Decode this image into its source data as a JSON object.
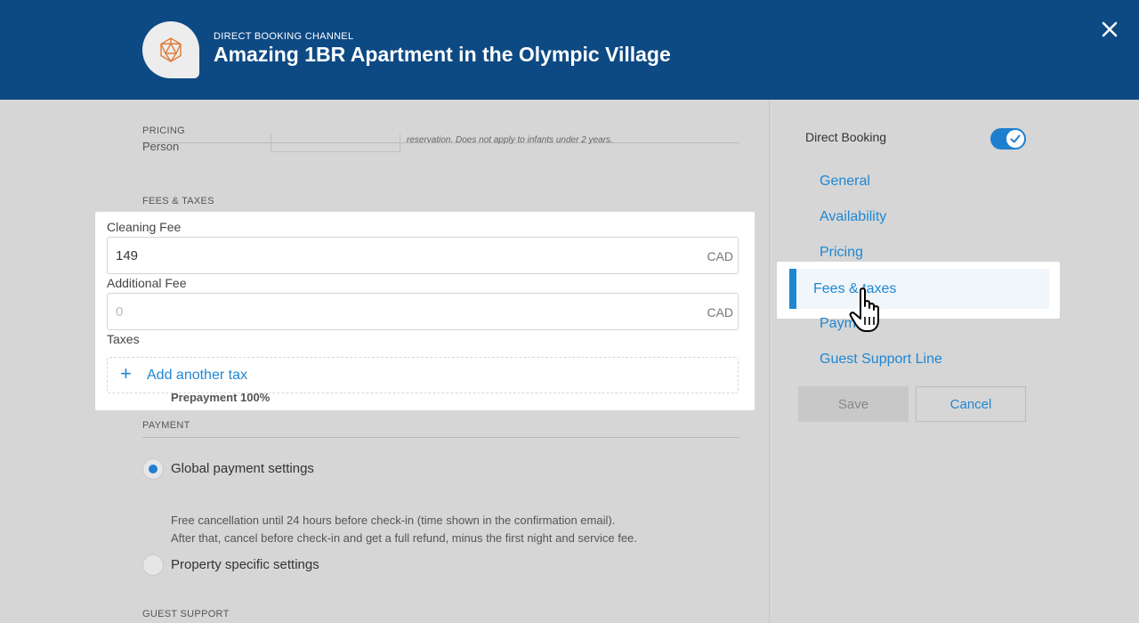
{
  "header": {
    "subtitle": "DIRECT BOOKING CHANNEL",
    "title": "Amazing 1BR Apartment in the Olympic Village"
  },
  "main": {
    "pricing_label": "PRICING",
    "pricing_prev_field_label": "Person",
    "pricing_prev_hint": "reservation. Does not apply to infants under 2 years.",
    "fees_label": "FEES & TAXES",
    "cleaning_fee": {
      "label": "Cleaning Fee",
      "value": "149",
      "unit": "CAD"
    },
    "additional_fee": {
      "label": "Additional Fee",
      "placeholder": "0",
      "unit": "CAD"
    },
    "taxes_label": "Taxes",
    "add_tax_label": "Add another tax",
    "payment_label": "PAYMENT",
    "payment_options": [
      {
        "label": "Global payment settings",
        "selected": true
      },
      {
        "label": "Property specific settings",
        "selected": false
      }
    ],
    "prepayment": "Prepayment 100%",
    "policy_line_1": "Free cancellation until 24 hours before check-in (time shown in the confirmation email).",
    "policy_line_2": "After that, cancel before check-in and get a full refund, minus the first night and service fee.",
    "guest_support_label": "GUEST SUPPORT"
  },
  "sidebar": {
    "toggle_label": "Direct Booking",
    "toggle_on": true,
    "nav": [
      {
        "label": "General"
      },
      {
        "label": "Availability"
      },
      {
        "label": "Pricing"
      },
      {
        "label": "Fees & taxes",
        "active": true
      },
      {
        "label": "Payme"
      },
      {
        "label": "Guest Support Line"
      }
    ],
    "save_label": "Save",
    "cancel_label": "Cancel"
  },
  "colors": {
    "header_bg": "#0d4a84",
    "accent": "#1f87d2",
    "logo_accent": "#e07b3a",
    "overlay_bg": "#d6d6d6"
  },
  "icons": {
    "logo": "polyhedron-logo-icon",
    "close": "close-icon",
    "plus": "plus-icon",
    "check": "check-icon",
    "cursor": "hand-pointer-cursor-icon"
  }
}
